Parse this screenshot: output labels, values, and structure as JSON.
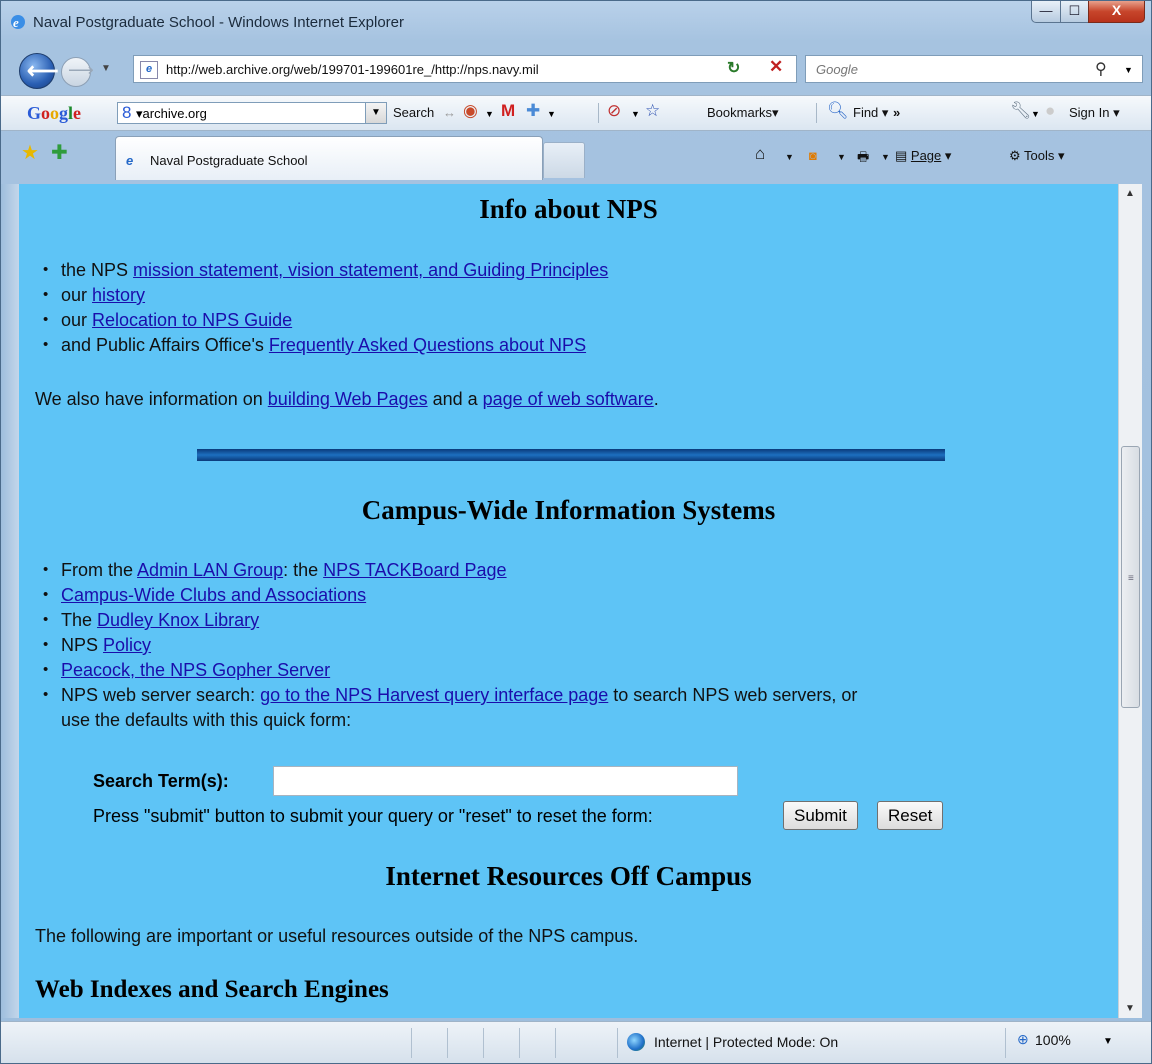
{
  "window": {
    "title": "Naval Postgraduate School - Windows Internet Explorer",
    "min_glyph": "—",
    "max_glyph": "☐",
    "close_glyph": "X"
  },
  "nav": {
    "url": "http://web.archive.org/web/199701-199601re_/http://nps.navy.mil",
    "search_placeholder": "Google"
  },
  "google_toolbar": {
    "logo": [
      "G",
      "o",
      "o",
      "g",
      "l",
      "e"
    ],
    "search_value": "archive.org",
    "search_label": "Search",
    "bookmarks_label": "Bookmarks",
    "find_label": "Find",
    "more_label": "»",
    "signin_label": "Sign In"
  },
  "tabs": {
    "active_label": "Naval Postgraduate School"
  },
  "commandbar": {
    "page_label": "Page",
    "tools_label": "Tools"
  },
  "content": {
    "info_heading": "Info about NPS",
    "info_items": [
      {
        "pre": "the NPS ",
        "link": "mission statement, vision statement, and Guiding Principles",
        "post": ""
      },
      {
        "pre": "our ",
        "link": "history",
        "post": ""
      },
      {
        "pre": "our ",
        "link": "Relocation to NPS Guide",
        "post": ""
      },
      {
        "pre": "and Public Affairs Office's ",
        "link": "Frequently Asked Questions about NPS",
        "post": ""
      }
    ],
    "also": {
      "pre": "We also have information on ",
      "link1": "building Web Pages",
      "mid": " and a ",
      "link2": "page of web software",
      "post": "."
    },
    "cwis_heading": "Campus-Wide Information Systems",
    "cwis_items": {
      "i1_pre": "From the ",
      "i1_link1": "Admin LAN Group",
      "i1_mid": ": the ",
      "i1_link2": "NPS TACKBoard Page",
      "i2_link": "Campus-Wide Clubs and Associations",
      "i3_pre": "The ",
      "i3_link": "Dudley Knox Library",
      "i4_pre": "NPS ",
      "i4_link": "Policy",
      "i5_link": "Peacock, the NPS Gopher Server",
      "i6_pre": "NPS web server search: ",
      "i6_link": "go to the NPS Harvest query interface page",
      "i6_post": " to search NPS web servers, or",
      "i6_line2": "use the defaults with this quick form:"
    },
    "form": {
      "search_label": "Search Term(s):",
      "search_value": "",
      "press_text": "Press \"submit\" button to submit your query or \"reset\" to reset the form:",
      "submit_label": "Submit",
      "reset_label": "Reset"
    },
    "internet_heading": "Internet Resources Off Campus",
    "internet_text": "The following are important or useful resources outside of the NPS campus.",
    "web_indexes_heading": "Web Indexes and Search Engines"
  },
  "status": {
    "zone_text": "Internet | Protected Mode: On",
    "zoom_text": "100%"
  }
}
